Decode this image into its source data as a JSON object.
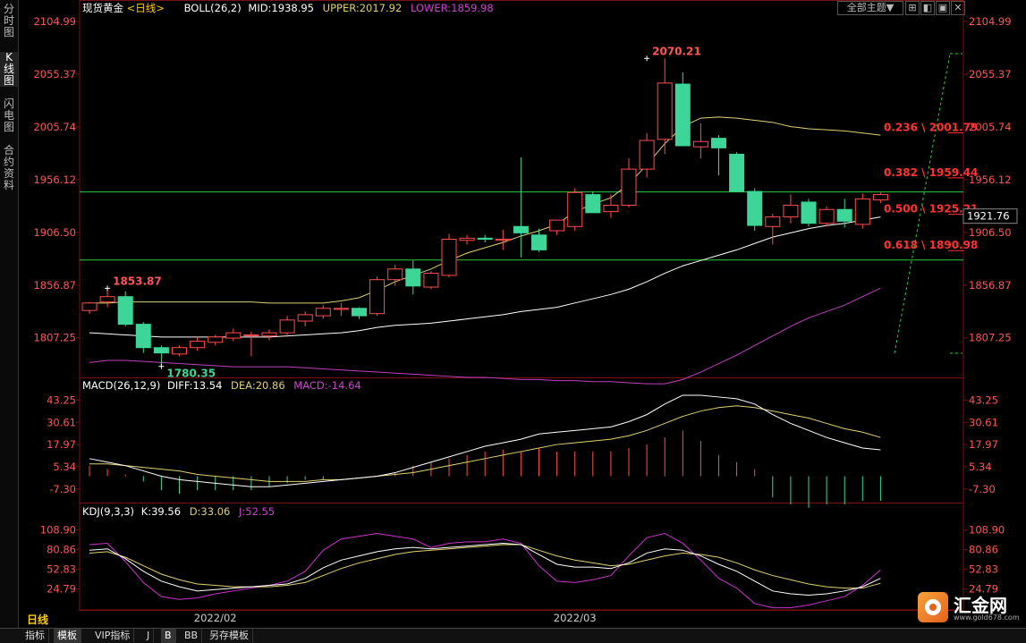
{
  "sidebar": {
    "tabs": [
      {
        "label": "分时图",
        "active": false
      },
      {
        "label": "K线图",
        "active": true
      },
      {
        "label": "闪电图",
        "active": false
      },
      {
        "label": "合约资料",
        "active": false
      }
    ]
  },
  "toolbar": {
    "theme_label": "全部主题▼",
    "window_buttons": [
      "⊞",
      "◧",
      "▣",
      "✕"
    ]
  },
  "main_header": {
    "symbol": "现货黄金",
    "period": "<日线>",
    "indicator": "BOLL(26,2)",
    "mid": "MID:1938.95",
    "upper": "UPPER:2017.92",
    "lower": "LOWER:1859.98"
  },
  "macd_header": {
    "name": "MACD(26,12,9)",
    "diff": "DIFF:13.54",
    "dea": "DEA:20.86",
    "macd": "MACD:-14.64"
  },
  "kdj_header": {
    "name": "KDJ(9,3,3)",
    "k": "K:39.56",
    "d": "D:33.06",
    "j": "J:52.55"
  },
  "bottom": {
    "period_label": "日线",
    "tabs": [
      {
        "label": "指标",
        "active": false
      },
      {
        "label": "模板",
        "active": true
      },
      {
        "label": "VIP指标",
        "active": false
      },
      {
        "label": "J",
        "active": false
      },
      {
        "label": "B",
        "active": true
      },
      {
        "label": "BB",
        "active": false
      },
      {
        "label": "另存模板",
        "active": false
      }
    ]
  },
  "logo": {
    "name": "汇金网",
    "url": "www.gold678.com"
  },
  "colors": {
    "up": "#ff4d4d",
    "down": "#3dd598",
    "mid": "#ffffff",
    "upper": "#e0d070",
    "lower": "#c040c0",
    "fib": "#ff3333",
    "grid": "#7a1010",
    "hline": "#2ecc40",
    "k": "#ffffff",
    "d": "#e0d070",
    "j": "#cc33cc"
  },
  "chart_data": [
    {
      "type": "candlestick",
      "y_ticks": [
        "2104.99",
        "2055.37",
        "2005.74",
        "1956.12",
        "1906.50",
        "1856.87",
        "1807.25"
      ],
      "y_tick_values": [
        2104.99,
        2055.37,
        2005.74,
        1956.12,
        1906.5,
        1856.87,
        1807.25
      ],
      "ylim": [
        1770,
        2110
      ],
      "x_labels": [
        {
          "label": "2022/02",
          "index": 7
        },
        {
          "label": "2022/03",
          "index": 27
        }
      ],
      "current_price": "1921.76",
      "current_price_value": 1921.76,
      "annotations": [
        {
          "text": "2070.21",
          "index": 31,
          "value": 2070.21
        },
        {
          "text": "1853.87",
          "index": 1,
          "value": 1853.87
        },
        {
          "text": "1780.35",
          "index": 4,
          "value": 1780.35
        }
      ],
      "fib_levels": [
        {
          "text": "0.236 \\ 2001.79",
          "value": 2001.79
        },
        {
          "text": "0.382 \\ 1959.44",
          "value": 1959.44
        },
        {
          "text": "0.500 \\ 1925.21",
          "value": 1925.21
        },
        {
          "text": "0.618 \\ 1890.98",
          "value": 1890.98
        }
      ],
      "horizontal_lines": [
        1944.5,
        1880.5
      ],
      "candles": [
        [
          1833,
          1841,
          1830,
          1840
        ],
        [
          1841,
          1853.87,
          1836,
          1846
        ],
        [
          1846,
          1851,
          1818,
          1820
        ],
        [
          1820,
          1822,
          1793,
          1798
        ],
        [
          1798,
          1800,
          1780.35,
          1793
        ],
        [
          1792,
          1800,
          1790,
          1798
        ],
        [
          1798,
          1808,
          1795,
          1804
        ],
        [
          1803,
          1810,
          1800,
          1808
        ],
        [
          1807,
          1816,
          1804,
          1812
        ],
        [
          1810,
          1813,
          1790,
          1810
        ],
        [
          1809,
          1815,
          1805,
          1812
        ],
        [
          1812,
          1828,
          1808,
          1824
        ],
        [
          1823,
          1832,
          1818,
          1829
        ],
        [
          1828,
          1838,
          1825,
          1835
        ],
        [
          1834,
          1840,
          1828,
          1835
        ],
        [
          1835,
          1836,
          1825,
          1828
        ],
        [
          1830,
          1865,
          1828,
          1862
        ],
        [
          1862,
          1876,
          1856,
          1872
        ],
        [
          1872,
          1880,
          1848,
          1856
        ],
        [
          1855,
          1870,
          1853,
          1868
        ],
        [
          1866,
          1905,
          1864,
          1900
        ],
        [
          1899,
          1904,
          1895,
          1901
        ],
        [
          1901,
          1904,
          1897,
          1900
        ],
        [
          1899,
          1909,
          1890,
          1900
        ],
        [
          1912,
          1977,
          1883,
          1906
        ],
        [
          1904,
          1910,
          1888,
          1890
        ],
        [
          1908,
          1918,
          1904,
          1918
        ],
        [
          1912,
          1948,
          1908,
          1944
        ],
        [
          1942,
          1945,
          1925,
          1925
        ],
        [
          1926,
          1942,
          1920,
          1932
        ],
        [
          1932,
          1976,
          1930,
          1966
        ],
        [
          1966,
          2000,
          1958,
          1993
        ],
        [
          1994,
          2070.21,
          1980,
          2047
        ],
        [
          2046,
          2057,
          1988,
          1988
        ],
        [
          1987,
          2009,
          1976,
          1992
        ],
        [
          1995,
          1998,
          1960,
          1986
        ],
        [
          1980,
          1982,
          1945,
          1945
        ],
        [
          1945,
          1948,
          1908,
          1913
        ],
        [
          1912,
          1924,
          1895,
          1921
        ],
        [
          1921,
          1942,
          1915,
          1932
        ],
        [
          1935,
          1938,
          1912,
          1915
        ],
        [
          1915,
          1931,
          1912,
          1928
        ],
        [
          1928,
          1938,
          1911,
          1917
        ],
        [
          1914,
          1943,
          1910,
          1938
        ],
        [
          1937,
          1944,
          1934,
          1942
        ]
      ],
      "boll_mid": [
        1812,
        1811,
        1810,
        1809,
        1808,
        1808,
        1808,
        1808,
        1808,
        1808,
        1808,
        1809,
        1810,
        1811,
        1812,
        1814,
        1817,
        1819,
        1820,
        1821,
        1823,
        1825,
        1827,
        1829,
        1832,
        1834,
        1836,
        1840,
        1844,
        1848,
        1853,
        1860,
        1868,
        1875,
        1880,
        1885,
        1890,
        1896,
        1902,
        1906,
        1910,
        1913,
        1915,
        1918,
        1921
      ],
      "boll_upper": [
        1840,
        1840,
        1841,
        1841,
        1841,
        1841,
        1841,
        1841,
        1841,
        1841,
        1840,
        1840,
        1840,
        1840,
        1842,
        1845,
        1852,
        1860,
        1866,
        1872,
        1880,
        1887,
        1892,
        1897,
        1903,
        1908,
        1914,
        1926,
        1933,
        1939,
        1952,
        1970,
        1990,
        2006,
        2014,
        2015,
        2014,
        2012,
        2010,
        2006,
        2004,
        2003,
        2002,
        2000,
        1998
      ],
      "boll_lower": [
        1784,
        1786,
        1786,
        1785,
        1784,
        1783,
        1782,
        1781,
        1780,
        1780,
        1780,
        1780,
        1779,
        1778,
        1777,
        1776,
        1775,
        1774,
        1773,
        1772,
        1771,
        1770,
        1770,
        1769,
        1768,
        1768,
        1767,
        1767,
        1766,
        1766,
        1765,
        1764,
        1764,
        1768,
        1775,
        1783,
        1791,
        1800,
        1809,
        1818,
        1826,
        1832,
        1838,
        1846,
        1854
      ]
    },
    {
      "type": "macd",
      "y_ticks": [
        "43.25",
        "30.61",
        "17.97",
        "5.34",
        "-7.30"
      ],
      "y_tick_values": [
        43.25,
        30.61,
        17.97,
        5.34,
        -7.3
      ],
      "ylim": [
        -15,
        47
      ],
      "diff": [
        10,
        8,
        6,
        3,
        0,
        -2,
        -3,
        -4,
        -5,
        -6,
        -6,
        -5,
        -4,
        -3,
        -2,
        -1,
        0,
        2,
        5,
        8,
        11,
        14,
        17,
        19,
        21,
        24,
        25,
        26,
        27,
        28,
        31,
        35,
        41,
        46,
        46,
        45,
        44,
        41,
        35,
        30,
        26,
        22,
        19,
        16,
        15
      ],
      "dea": [
        7,
        7,
        6,
        5,
        4,
        3,
        1,
        0,
        -1,
        -2,
        -3,
        -3,
        -3,
        -2,
        -2,
        -1,
        0,
        1,
        2,
        4,
        6,
        8,
        10,
        12,
        14,
        16,
        18,
        19,
        20,
        21,
        23,
        26,
        30,
        34,
        37,
        39,
        40,
        39,
        37,
        35,
        33,
        30,
        27,
        25,
        22
      ],
      "hist": [
        6,
        4,
        1,
        -3,
        -8,
        -10,
        -8,
        -8,
        -8,
        -8,
        -6,
        -4,
        -2,
        -2,
        0,
        0,
        0,
        2,
        6,
        8,
        10,
        12,
        14,
        15,
        14,
        16,
        14,
        14,
        14,
        14,
        16,
        18,
        22,
        26,
        20,
        12,
        8,
        4,
        -12,
        -16,
        -18,
        -16,
        -16,
        -14,
        -14
      ]
    },
    {
      "type": "kdj",
      "y_ticks": [
        "108.90",
        "80.86",
        "52.83",
        "24.79"
      ],
      "y_tick_values": [
        108.9,
        80.86,
        52.83,
        24.79
      ],
      "ylim": [
        -5,
        125
      ],
      "k": [
        80,
        82,
        68,
        50,
        36,
        28,
        22,
        24,
        26,
        28,
        30,
        32,
        40,
        55,
        66,
        72,
        78,
        82,
        84,
        82,
        84,
        86,
        88,
        90,
        88,
        74,
        60,
        56,
        56,
        54,
        62,
        76,
        82,
        80,
        72,
        60,
        50,
        36,
        22,
        18,
        16,
        18,
        22,
        28,
        40
      ],
      "d": [
        76,
        78,
        70,
        58,
        46,
        38,
        32,
        30,
        28,
        28,
        28,
        30,
        34,
        44,
        54,
        62,
        68,
        74,
        78,
        80,
        82,
        84,
        86,
        88,
        88,
        80,
        72,
        66,
        62,
        58,
        60,
        66,
        72,
        76,
        74,
        70,
        62,
        52,
        44,
        38,
        32,
        28,
        26,
        26,
        33
      ],
      "j": [
        88,
        90,
        64,
        34,
        14,
        10,
        12,
        18,
        22,
        26,
        30,
        36,
        50,
        80,
        96,
        100,
        104,
        100,
        96,
        84,
        90,
        92,
        92,
        96,
        90,
        58,
        36,
        34,
        38,
        44,
        72,
        98,
        104,
        90,
        66,
        40,
        26,
        4,
        -2,
        -2,
        2,
        8,
        14,
        30,
        52
      ]
    }
  ]
}
